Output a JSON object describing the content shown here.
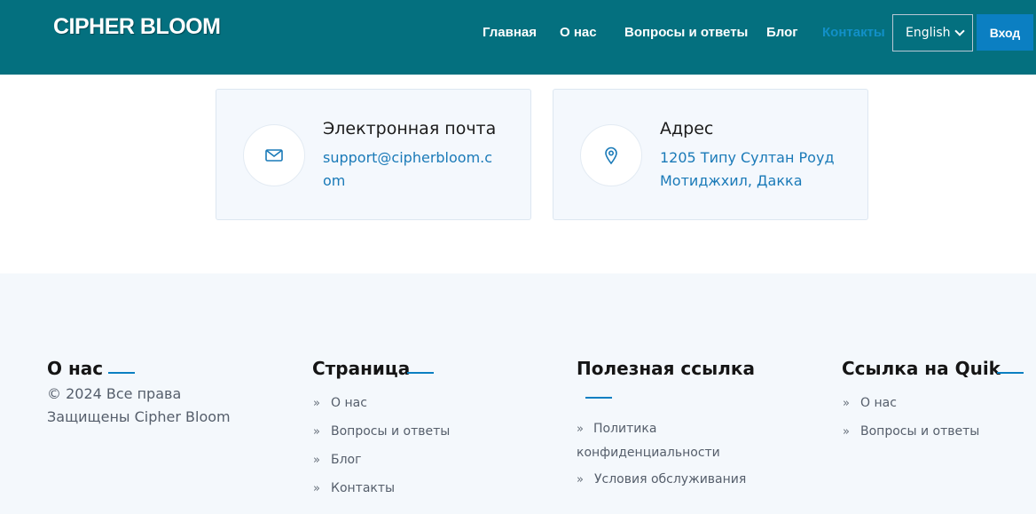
{
  "header": {
    "logo": "CIPHER BLOOM",
    "nav": [
      "Главная",
      "О нас",
      "Вопросы и ответы",
      "Блог",
      "Контакты"
    ],
    "active_nav": "Контакты",
    "language": "English",
    "login": "Вход"
  },
  "contacts": [
    {
      "icon": "envelope-icon",
      "title": "Электронная почта",
      "text": "support@cipherbloom.com"
    },
    {
      "icon": "map-pin-icon",
      "title": "Адрес",
      "text_lines": [
        "1205 Типу Султан Роуд",
        "Мотиджхил, Дакка"
      ]
    }
  ],
  "footer": {
    "about": {
      "title": "О нас",
      "text_lines": [
        "© 2024 Все права",
        "Защищены Cipher Bloom"
      ]
    },
    "pages": {
      "title": "Страница",
      "links": [
        "О нас",
        "Вопросы и ответы",
        "Блог",
        "Контакты"
      ]
    },
    "useful": {
      "title": "Полезная ссылка",
      "links": [
        "Политика конфиденциальности",
        "Условия обслуживания"
      ]
    },
    "quick": {
      "title": "Ссылка на Quik",
      "links": [
        "О нас",
        "Вопросы и ответы"
      ]
    }
  },
  "colors": {
    "header_bg": "#04707f",
    "accent": "#0b7fc2",
    "active_nav": "#1290c8",
    "footer_bg": "#f4f8fc"
  }
}
